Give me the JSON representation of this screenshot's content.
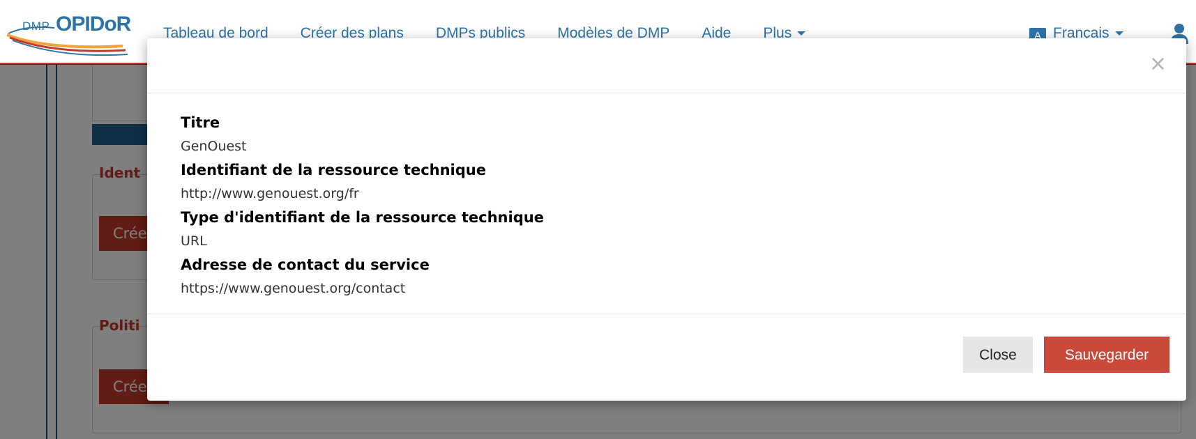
{
  "navbar": {
    "logo_prefix": "DMP",
    "logo_name": "OPIDoR",
    "items": [
      {
        "label": "Tableau de bord"
      },
      {
        "label": "Créer des plans"
      },
      {
        "label": "DMPs publics"
      },
      {
        "label": "Modèles de DMP"
      },
      {
        "label": "Aide"
      },
      {
        "label": "Plus"
      }
    ],
    "language": "Français",
    "accent_color": "#2e73a8"
  },
  "background_page": {
    "section_1_title": "Ident",
    "section_1_button": "Crée",
    "section_2_title": "Politi",
    "section_2_button": "Crée",
    "title_color": "#c0392b"
  },
  "modal": {
    "close_symbol": "×",
    "fields": [
      {
        "label": "Titre",
        "value": "GenOuest"
      },
      {
        "label": "Identifiant de la ressource technique",
        "value": "http://www.genouest.org/fr"
      },
      {
        "label": "Type d'identifiant de la ressource technique",
        "value": "URL"
      },
      {
        "label": "Adresse de contact du service",
        "value": "https://www.genouest.org/contact"
      }
    ],
    "close_button": "Close",
    "save_button": "Sauvegarder",
    "save_color": "#c9493a"
  }
}
